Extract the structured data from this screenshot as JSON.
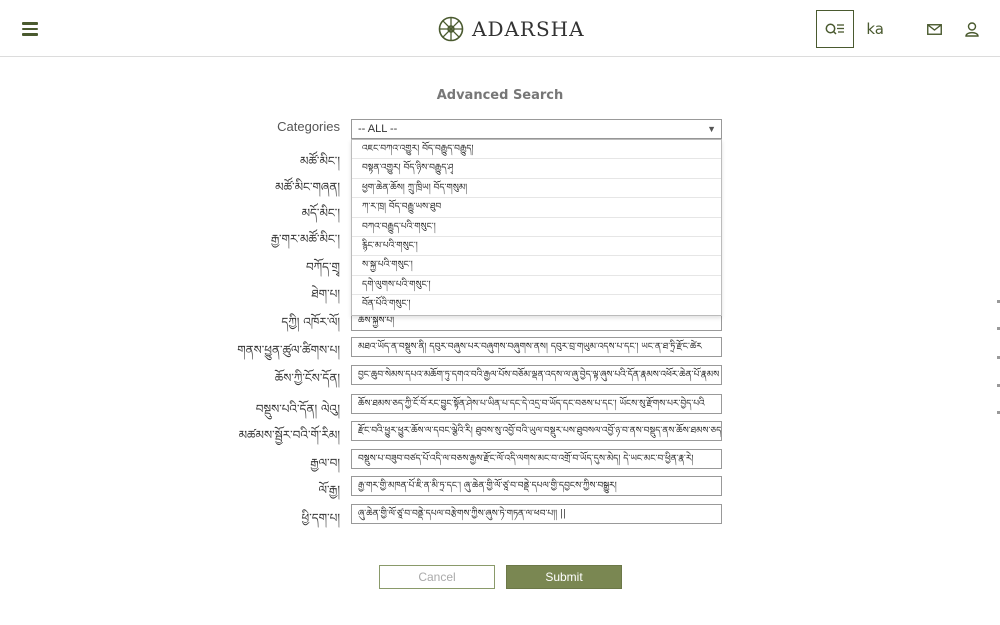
{
  "header": {
    "menu_icon": "hamburger-icon",
    "logo_text": "ADARSHA",
    "lang_label": "ka",
    "icons": [
      "search-list-icon",
      "mail-icon",
      "user-icon"
    ],
    "accent_color": "#4a5a2f"
  },
  "page": {
    "title": "Advanced Search"
  },
  "categories": {
    "label": "Categories",
    "selected": "-- ALL --",
    "options": [
      "འཇང་བཀའ་འགྱུར། བོད་བརྒྱུད་བརྒྱུད།",
      "བསྟན་འགྱུར། བོད་ཉིས་བརྒྱུད་ཤྭ",
      "ཕྱག་ཆེན་ཆོས། ཀྲུ་ཁྲིཡ། བོད་གསུམ།",
      "ཀ་ར་ཁྲ། བོད་བརྒྱུ་ཡས་ཐུབ",
      "བཀའ་བརྒྱུད་པའི་གསུང་།",
      "རྙིང་མ་པའི་གསུང་།",
      "ས་སྐྱ་པའི་གསུང་།",
      "དགེ་ལུགས་པའི་གསུང་།",
      "བོན་པོའི་གསུང་།"
    ]
  },
  "fields": [
    {
      "label": "མཚོ་མིང་།",
      "value": ""
    },
    {
      "label": "མཚོ་མིང་གཞན།",
      "value": ""
    },
    {
      "label": "མདོ་མིང་།",
      "value": ""
    },
    {
      "label": "རྒྱ་གར་མཚོ་མིང་།",
      "value": ""
    },
    {
      "label": "བཀོད་གྲྭ",
      "value": ""
    },
    {
      "label": "ཐེག་པ།",
      "value": ""
    },
    {
      "label": "དཀྱི། འཁོར་ལོ།",
      "value": "ཆོས་སྐྱེས་པ།"
    },
    {
      "label": "གནས་ཕྱུན་ཚུལ་ཚིགས་པ།",
      "value": "མཐའ་ཡོད་ན་བསྡུས་ནི། དབུར་བཞུས་པར་བཞུགས་བཞུགས་ནས། དབུར་བྲ་གཡུམ་འདས་པ་དང་། ཡང་ན་ཐ་ཏྲི་རྫོང་ཚེར"
    },
    {
      "label": "ཆོས་ཀྱི་ངོས་དོན།",
      "value": "བྱང་ཆུབ་སེམས་དཔའ་མཆོག་ཏུ་དགའ་བའི་རྒྱལ་པོས་བཅོམ་ལྡན་འདས་ལ་ཞུ་བྱེད་ལྟ་ཞུས་པའི་དོན་རྣམས་འཕོར་ཆེན་པོ་རྣམས"
    },
    {
      "label": "བསྡུས་པའི་དོན། ལེའུ།",
      "value": "ཆོས་ཐམས་ཅད་ཀྱི་ངོ་བོ་རང་བྱུང་སྟོན་ཤེས་པ་ཡིན་པ་དང་དེ་འདྲ་བ་ཡོད་དང་བཅས་པ་དང་། ཡོངས་སུ་རྫོགས་པར་བྱེད་པའི"
    },
    {
      "label": "མཚམས་སྦྱོར་བའི་གོ་རིམ།",
      "value": "རྫོང་བའི་ཕྱུར་ཕྱུར་ཆོས་ལ་དབང་ལྕེའི་རི། ཐུབས་སུ་འབྱོ་བའི་ཡུལ་བསྡུར་པས་ཐུབསལ་འབྱོ་ཉ་བ་ནས་བསྡུད་ནས་ཆོས་ཐམས་ཅད་ཀྱི་ཚོ"
    },
    {
      "label": "རྒྱལ་བ།",
      "value": "བསྡུས་པ་བཟུབ་བཙད་པོ་འདི་ལ་བཅས་རྒྱས་རྫོང་ལོ་འདི་ལགས་མང་བ་འགྲོ་བ་ཡོད་དུས་མེད། དེ་ཡང་མང་བ་ཕྱིན་རྣ་རེ།"
    },
    {
      "label": "ལོ་རྒྱ།",
      "value": "རྒྱ་གར་གྱི་མཁན་པོ་ཇི་ན་མི་ཏྲ་དང་། ཞུ་ཆེན་གྱི་ལོ་ཙཱ་བ་བནྡེ་དཔལ་གྱི་དབྱངས་ཀྱིས་བསྒྱུར།"
    },
    {
      "label": "ཕྱི་དག་པ།",
      "value": "ཞུ་ཆེན་གྱི་ལོ་ཙཱ་བ་བནྡེ་དཔལ་བརྩེགས་ཀྱིས་ཞུས་ཏེ་གཏན་ལ་ཕབ་པ།། ||"
    }
  ],
  "buttons": {
    "cancel": "Cancel",
    "submit": "Submit"
  }
}
